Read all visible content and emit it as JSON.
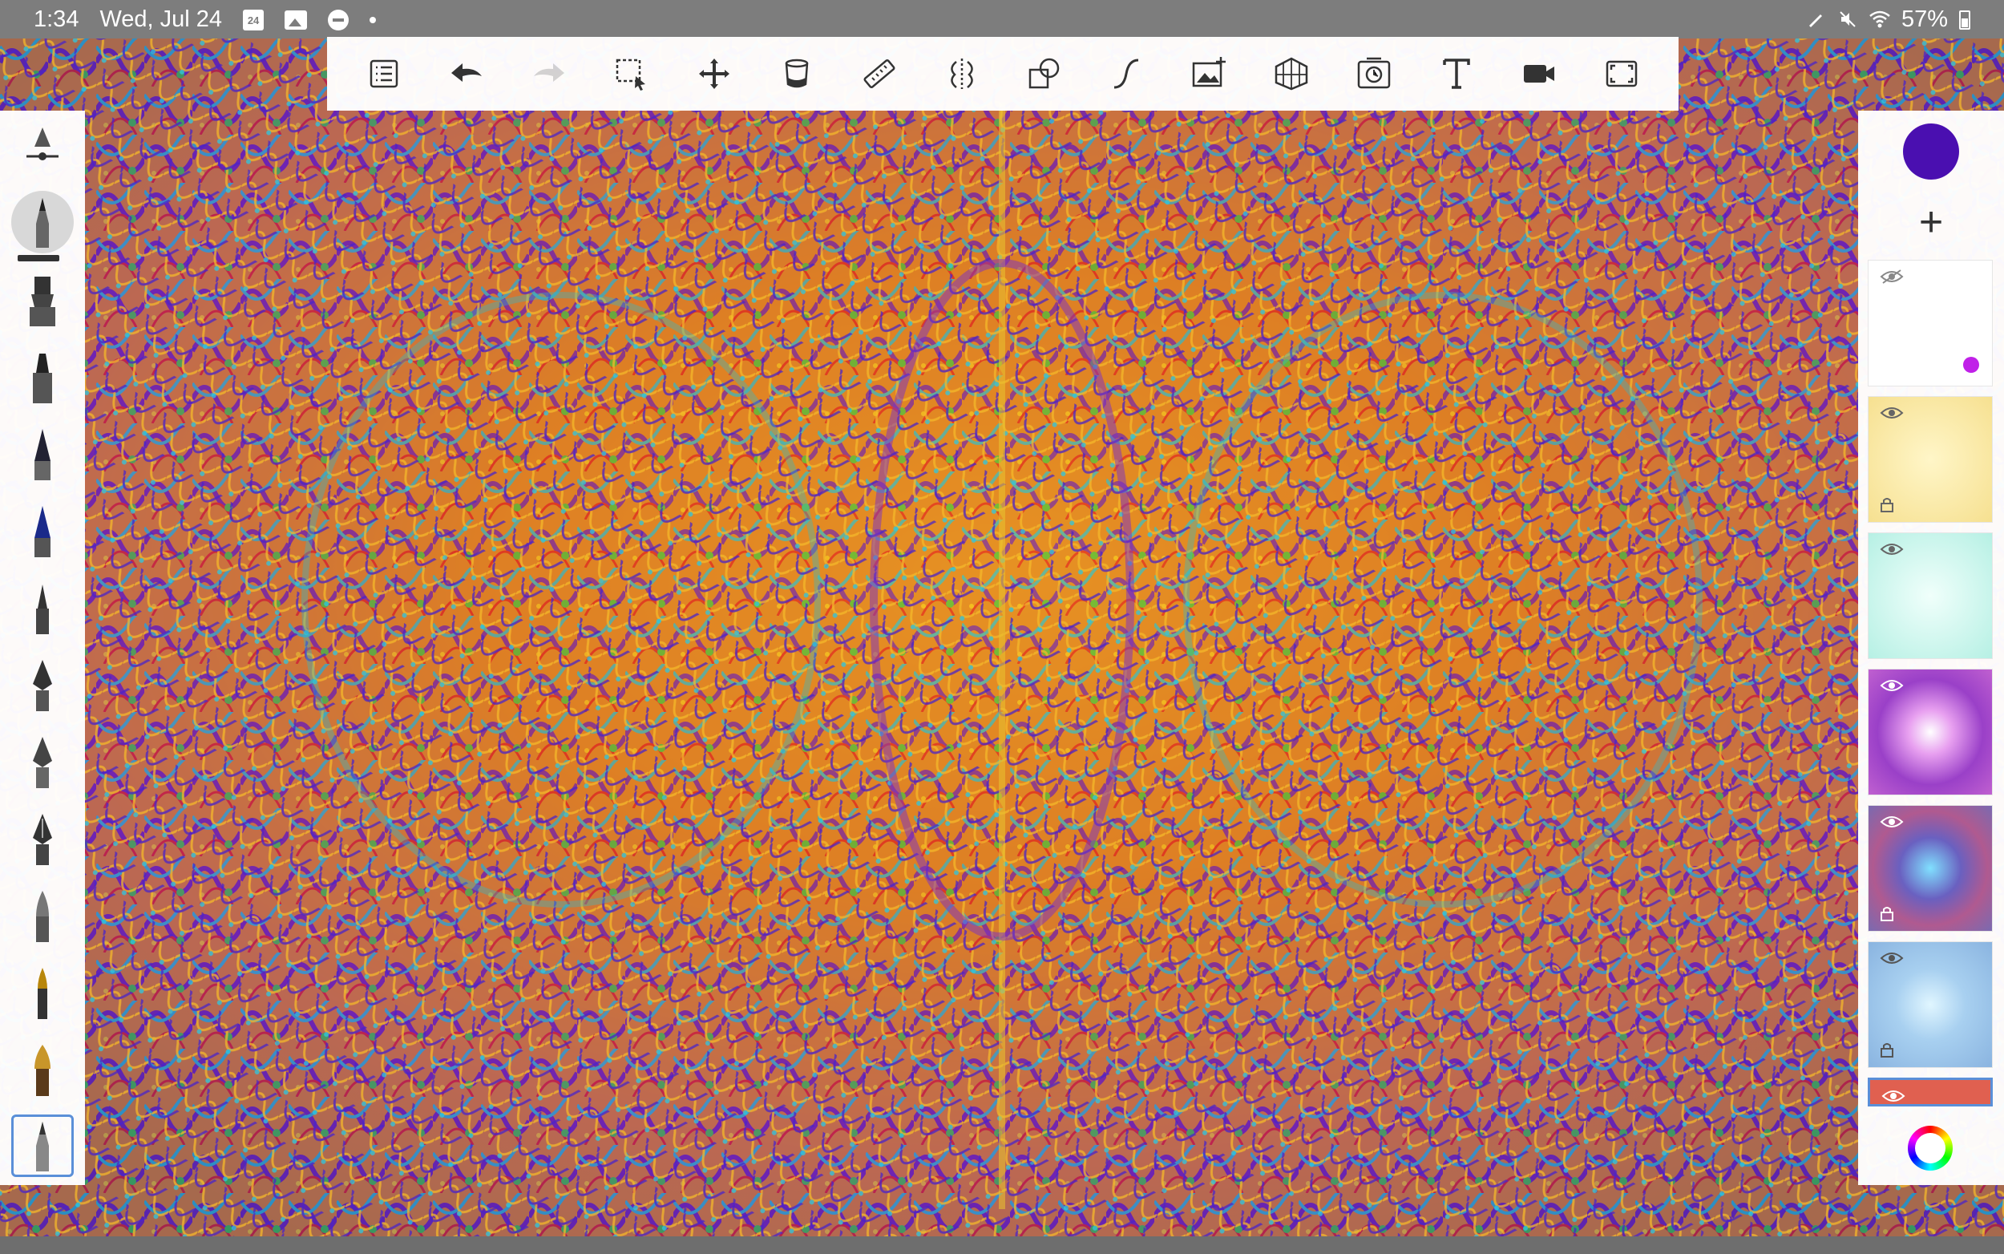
{
  "status_bar": {
    "time": "1:34",
    "date": "Wed, Jul 24",
    "calendar_day": "24",
    "battery": "57%"
  },
  "toolbar": {
    "items": [
      {
        "name": "layers-menu",
        "icon": "list-icon"
      },
      {
        "name": "undo",
        "icon": "undo-icon"
      },
      {
        "name": "redo",
        "icon": "redo-icon",
        "disabled": true
      },
      {
        "name": "selection",
        "icon": "selection-icon"
      },
      {
        "name": "transform",
        "icon": "move-icon"
      },
      {
        "name": "fill",
        "icon": "bucket-icon"
      },
      {
        "name": "ruler",
        "icon": "ruler-icon"
      },
      {
        "name": "symmetry",
        "icon": "symmetry-icon"
      },
      {
        "name": "shapes",
        "icon": "shapes-icon"
      },
      {
        "name": "curve",
        "icon": "curve-icon"
      },
      {
        "name": "import-image",
        "icon": "image-add-icon"
      },
      {
        "name": "perspective",
        "icon": "perspective-grid-icon"
      },
      {
        "name": "time-lapse",
        "icon": "timelapse-icon"
      },
      {
        "name": "text",
        "icon": "text-icon"
      },
      {
        "name": "record",
        "icon": "video-icon"
      },
      {
        "name": "fullscreen",
        "icon": "fullscreen-icon"
      }
    ]
  },
  "brushes": {
    "items": [
      "airbrush",
      "pencil",
      "marker",
      "felt-tip",
      "ballpoint",
      "fineliner",
      "ink-pen",
      "calligraphy-pen",
      "technical-pen",
      "fountain-pen",
      "brush-pen",
      "paint-brush",
      "paint-brush-wide",
      "eraser"
    ],
    "selected_index": 13
  },
  "right_panel": {
    "current_color": "#4a0fb0",
    "add_layer_symbol": "+",
    "layers": [
      {
        "visible": false,
        "locked": false,
        "style": "white",
        "marker_color": "#c020e8"
      },
      {
        "visible": true,
        "locked": true,
        "style": "yellow"
      },
      {
        "visible": true,
        "locked": false,
        "style": "mint"
      },
      {
        "visible": true,
        "locked": false,
        "style": "violet"
      },
      {
        "visible": true,
        "locked": true,
        "style": "rainbow"
      },
      {
        "visible": true,
        "locked": true,
        "style": "blue"
      },
      {
        "visible": true,
        "locked": false,
        "style": "red"
      }
    ]
  },
  "colors": {
    "accent": "#5a8fd8",
    "status_bar_bg": "#7d7d7d"
  }
}
